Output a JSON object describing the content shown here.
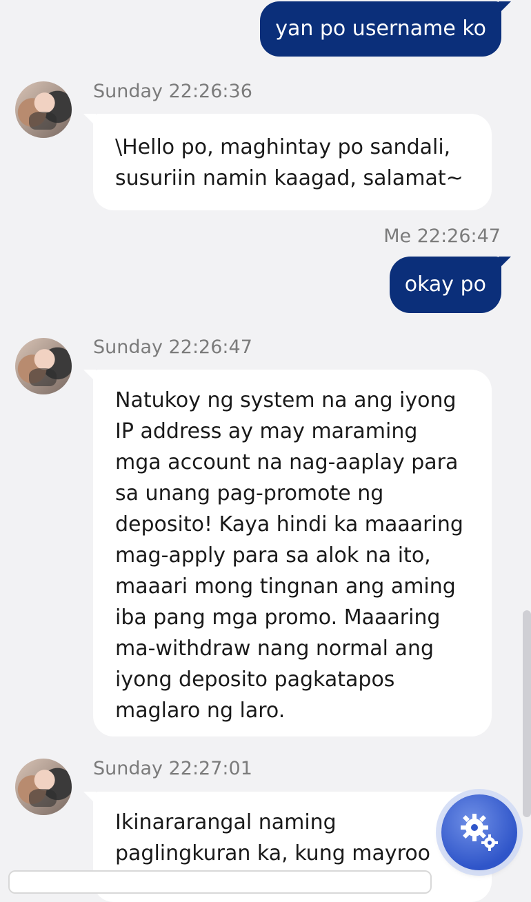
{
  "messages": {
    "out1": {
      "text": "yan po username ko"
    },
    "in1": {
      "sender_time": "Sunday 22:26:36",
      "text": "\\Hello po, maghintay po sandali, susuriin namin kaagad, salamat~"
    },
    "out2": {
      "sender_time": "Me 22:26:47",
      "text": "okay po"
    },
    "in2": {
      "sender_time": "Sunday 22:26:47",
      "text": "Natukoy ng system na ang iyong IP address ay may maraming mga account na nag-aaplay para sa unang pag-promote ng deposito! Kaya hindi ka maaaring mag-apply para sa alok na ito, maaari mong tingnan ang aming iba pang mga promo. Maaaring ma-withdraw nang normal ang iyong deposito pagkatapos maglaro ng laro."
    },
    "in3": {
      "sender_time": "Sunday 22:27:01",
      "text": "Ikinararangal naming paglingkuran ka, kung mayroo"
    }
  },
  "icons": {
    "settings": "gears-icon",
    "avatar": "agent-avatar"
  },
  "colors": {
    "outgoing_bubble": "#0b2f7a",
    "incoming_bubble": "#ffffff",
    "background": "#f2f2f4"
  }
}
